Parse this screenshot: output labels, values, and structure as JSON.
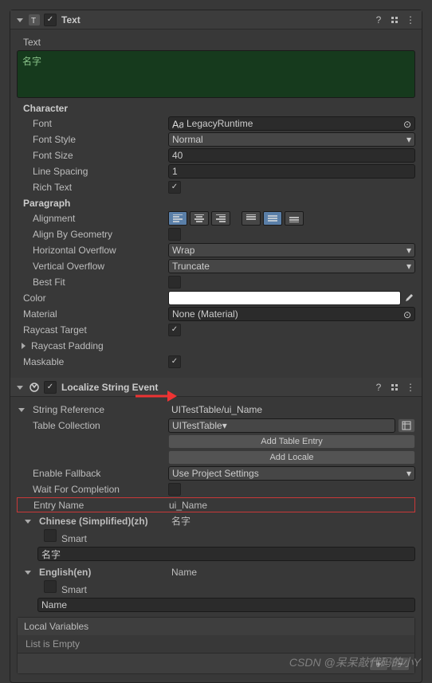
{
  "text_component": {
    "title": "Text",
    "text_label": "Text",
    "text_value": "名字",
    "sections": {
      "character": "Character",
      "paragraph": "Paragraph"
    },
    "fields": {
      "font": {
        "label": "Font",
        "value": "LegacyRuntime"
      },
      "font_style": {
        "label": "Font Style",
        "value": "Normal"
      },
      "font_size": {
        "label": "Font Size",
        "value": "40"
      },
      "line_spacing": {
        "label": "Line Spacing",
        "value": "1"
      },
      "rich_text": {
        "label": "Rich Text"
      },
      "alignment": {
        "label": "Alignment"
      },
      "align_by_geometry": {
        "label": "Align By Geometry"
      },
      "horizontal_overflow": {
        "label": "Horizontal Overflow",
        "value": "Wrap"
      },
      "vertical_overflow": {
        "label": "Vertical Overflow",
        "value": "Truncate"
      },
      "best_fit": {
        "label": "Best Fit"
      },
      "color": {
        "label": "Color"
      },
      "material": {
        "label": "Material",
        "value": "None (Material)"
      },
      "raycast_target": {
        "label": "Raycast Target"
      },
      "raycast_padding": {
        "label": "Raycast Padding"
      },
      "maskable": {
        "label": "Maskable"
      }
    }
  },
  "localize": {
    "title": "Localize String Event",
    "string_reference": {
      "label": "String Reference",
      "value": "UITestTable/ui_Name"
    },
    "table_collection": {
      "label": "Table Collection",
      "value": "UITestTable"
    },
    "add_table_entry": "Add Table Entry",
    "add_locale": "Add Locale",
    "enable_fallback": {
      "label": "Enable Fallback",
      "value": "Use Project Settings"
    },
    "wait_for_completion": {
      "label": "Wait For Completion"
    },
    "entry_name": {
      "label": "Entry Name",
      "value": "ui_Name"
    },
    "locales": {
      "zh": {
        "label": "Chinese (Simplified)(zh)",
        "value": "名字",
        "smart": "Smart",
        "input": "名字"
      },
      "en": {
        "label": "English(en)",
        "value": "Name",
        "smart": "Smart",
        "input": "Name"
      }
    },
    "local_variables": {
      "label": "Local Variables",
      "empty": "List is Empty"
    }
  },
  "watermark": "CSDN @呆呆敲代码的小Y"
}
